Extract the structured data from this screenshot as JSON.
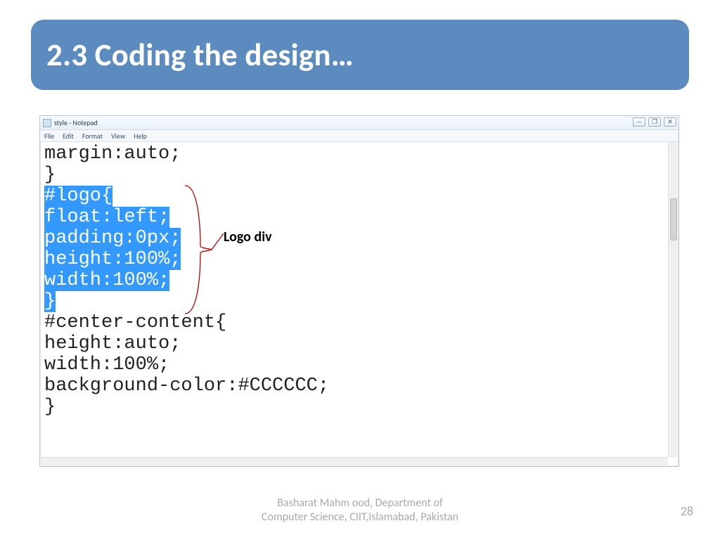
{
  "slide": {
    "title": "2.3 Coding the design…",
    "page_number": "28",
    "footer_line1": "Basharat Mahm ood, Department of",
    "footer_line2": "Computer Science, CIIT,Islamabad, Pakistan",
    "callout_label": "Logo div"
  },
  "notepad": {
    "window_title": "style - Notepad",
    "menus": {
      "file": "File",
      "edit": "Edit",
      "format": "Format",
      "view": "View",
      "help": "Help"
    },
    "win_btns": {
      "min": "—",
      "max": "❐",
      "close": "✕"
    },
    "code": {
      "l1": "margin:auto;",
      "l2": "}",
      "l3": "#logo{",
      "l4": "float:left;",
      "l5": "padding:0px;",
      "l6": "height:100%;",
      "l7": "width:100%;",
      "l8": "}",
      "l9": "#center-content{",
      "l10": "height:auto;",
      "l11": "width:100%;",
      "l12": "background-color:#CCCCCC;",
      "l13": "}"
    }
  }
}
